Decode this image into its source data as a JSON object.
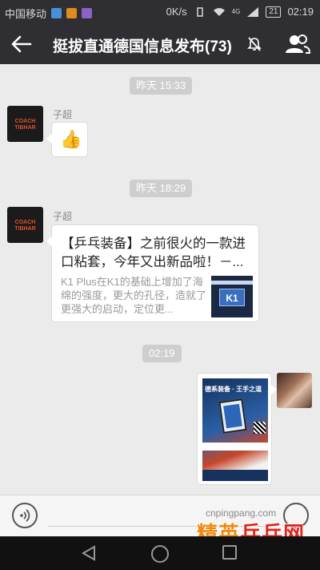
{
  "status_bar": {
    "carrier": "中国移动",
    "speed": "0K/s",
    "network": "4G",
    "battery": "21",
    "time": "02:19"
  },
  "header": {
    "title": "挺拔直通德国信息发布(73)",
    "back_icon": "arrow-left-icon",
    "mute_icon": "bell-muted-icon",
    "members_icon": "people-icon"
  },
  "messages": [
    {
      "type": "time",
      "text": "昨天 15:33"
    },
    {
      "type": "sticker",
      "sender": "子超",
      "avatar_text": "COACH TIBHAR",
      "content_icon": "thumbs-up-icon",
      "content": "👍"
    },
    {
      "type": "time",
      "text": "昨天 18:29"
    },
    {
      "type": "link",
      "sender": "子超",
      "avatar_text": "COACH TIBHAR",
      "title": "【乒乓装备】之前很火的一款进口粘套，今年又出新品啦！－...",
      "description": "K1 Plus在K1的基础上增加了海绵的强度，更大的孔径，造就了更强大的启动，定位更...",
      "thumb_text": "K1"
    },
    {
      "type": "time",
      "text": "02:19"
    },
    {
      "type": "image",
      "from_self": true,
      "image_caption": "德系装备 · 王手之道"
    }
  ],
  "input_bar": {
    "voice_icon": "voice-icon",
    "emoji_icon": "emoji-icon"
  },
  "watermark": {
    "url": "cnpingpang.com",
    "logo_a": "精英",
    "logo_b": "乒乓网"
  },
  "colors": {
    "dark_bar": "#2f2f33",
    "chat_bg": "#ebebeb",
    "time_badge": "#cecece",
    "accent": "#f08a10"
  }
}
